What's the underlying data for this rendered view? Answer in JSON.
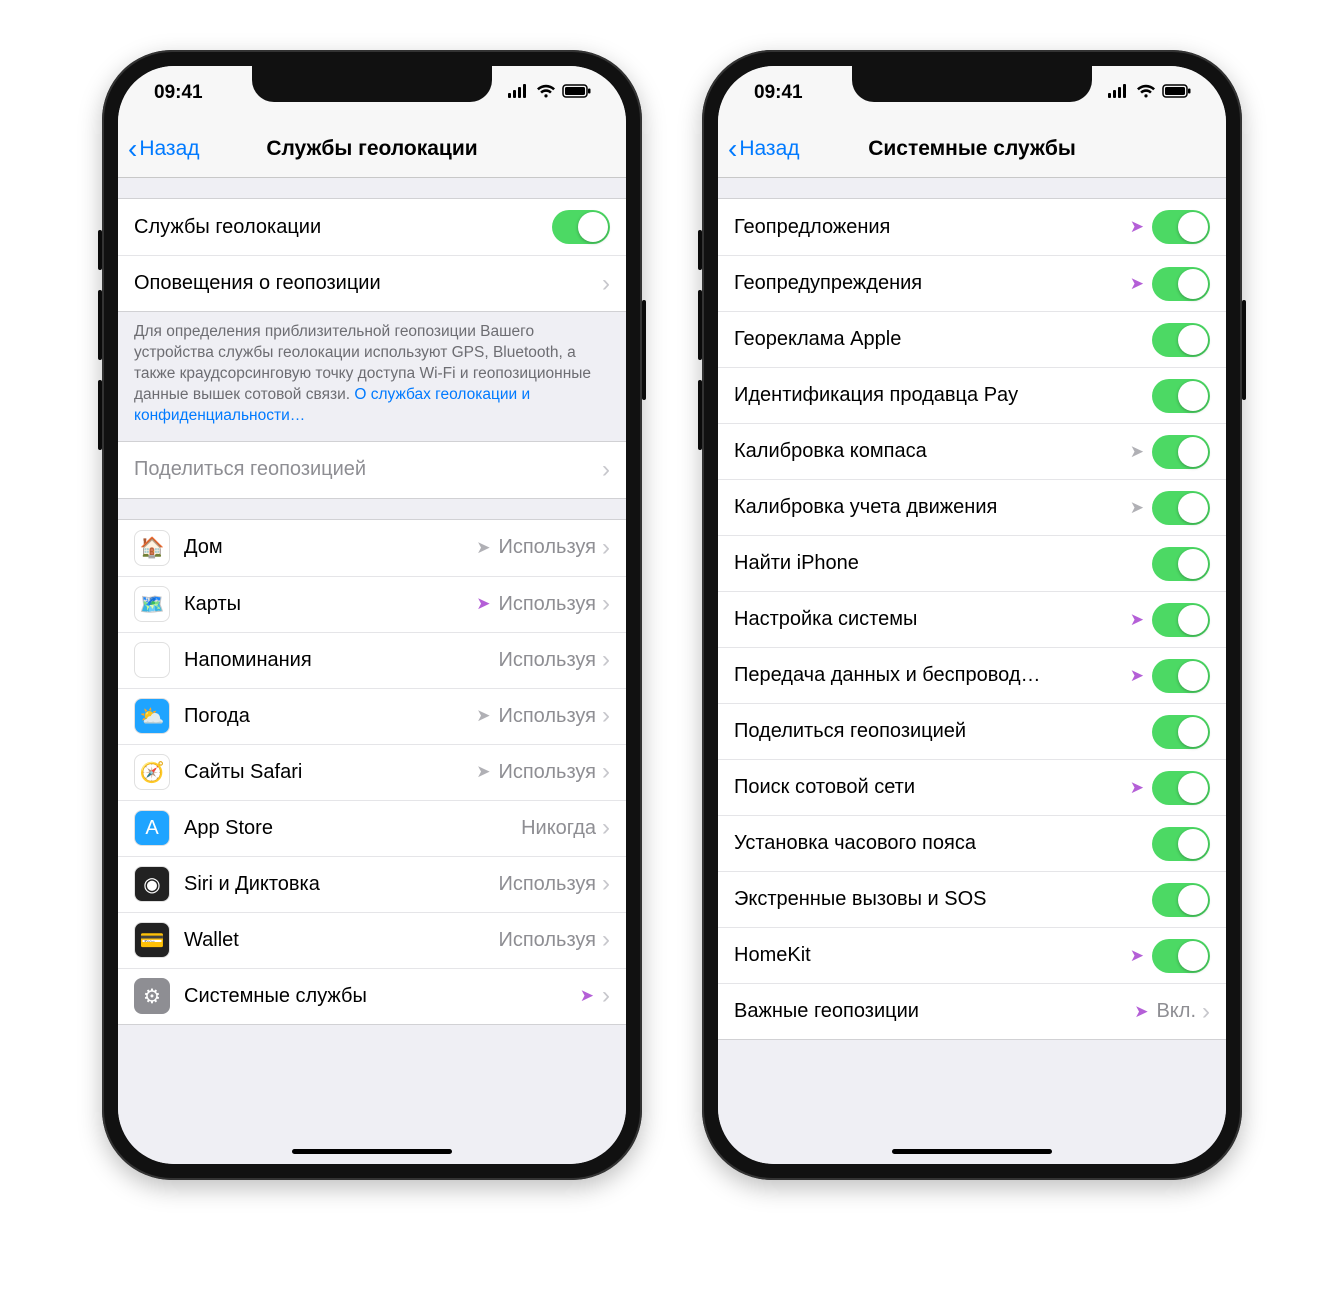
{
  "status": {
    "time": "09:41"
  },
  "left": {
    "back": "Назад",
    "title": "Службы геолокации",
    "toggle_label": "Службы геолокации",
    "alerts_label": "Оповещения о геопозиции",
    "footer_text": "Для определения приблизительной геопозиции Вашего устройства службы геолокации используют GPS, Bluetooth, а также краудсорсинговую точку доступа Wi-Fi и геопозиционные данные вышек сотовой связи. ",
    "footer_link": "О службах геолокации и конфиденциальности…",
    "share_label": "Поделиться геопозицией",
    "apps": [
      {
        "name": "Дом",
        "status": "Используя",
        "arrow": "gray",
        "bg": "#fff",
        "glyph": "🏠"
      },
      {
        "name": "Карты",
        "status": "Используя",
        "arrow": "purple",
        "bg": "#fff",
        "glyph": "🗺️"
      },
      {
        "name": "Напоминания",
        "status": "Используя",
        "arrow": "none",
        "bg": "#fff",
        "glyph": "☰"
      },
      {
        "name": "Погода",
        "status": "Используя",
        "arrow": "gray",
        "bg": "#1fa4ff",
        "glyph": "⛅"
      },
      {
        "name": "Сайты Safari",
        "status": "Используя",
        "arrow": "gray",
        "bg": "#fff",
        "glyph": "🧭"
      },
      {
        "name": "App Store",
        "status": "Никогда",
        "arrow": "none",
        "bg": "#1fa4ff",
        "glyph": "A"
      },
      {
        "name": "Siri и Диктовка",
        "status": "Используя",
        "arrow": "none",
        "bg": "#222",
        "glyph": "◉"
      },
      {
        "name": "Wallet",
        "status": "Используя",
        "arrow": "none",
        "bg": "#222",
        "glyph": "💳"
      }
    ],
    "system_label": "Системные службы"
  },
  "right": {
    "back": "Назад",
    "title": "Системные службы",
    "items": [
      {
        "label": "Геопредложения",
        "arrow": "purple"
      },
      {
        "label": "Геопредупреждения",
        "arrow": "purple"
      },
      {
        "label": "Геореклама Apple",
        "arrow": "none"
      },
      {
        "label": "Идентификация продавца Pay",
        "arrow": "none"
      },
      {
        "label": "Калибровка компаса",
        "arrow": "gray"
      },
      {
        "label": "Калибровка учета движения",
        "arrow": "gray"
      },
      {
        "label": "Найти iPhone",
        "arrow": "none"
      },
      {
        "label": "Настройка системы",
        "arrow": "purple"
      },
      {
        "label": "Передача данных и беспровод…",
        "arrow": "purple"
      },
      {
        "label": "Поделиться геопозицией",
        "arrow": "none"
      },
      {
        "label": "Поиск сотовой сети",
        "arrow": "purple"
      },
      {
        "label": "Установка часового пояса",
        "arrow": "none"
      },
      {
        "label": "Экстренные вызовы и SOS",
        "arrow": "none"
      },
      {
        "label": "HomeKit",
        "arrow": "purple"
      }
    ],
    "important_label": "Важные геопозиции",
    "important_value": "Вкл."
  }
}
